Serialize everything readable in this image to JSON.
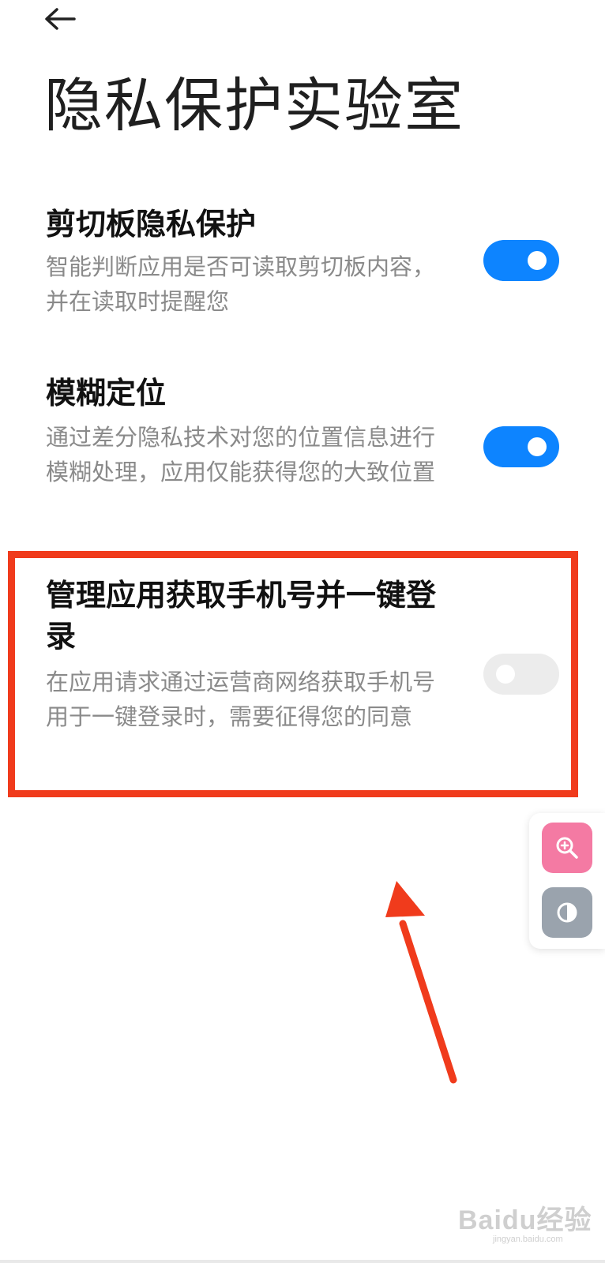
{
  "header": {
    "back_icon": "back-arrow-icon",
    "title": "隐私保护实验室"
  },
  "settings": [
    {
      "title": "剪切板隐私保护",
      "description": "智能判断应用是否可读取剪切板内容，并在读取时提醒您",
      "enabled": true
    },
    {
      "title": "模糊定位",
      "description": "通过差分隐私技术对您的位置信息进行模糊处理，应用仅能获得您的大致位置",
      "enabled": true
    },
    {
      "title": "管理应用获取手机号并一键登录",
      "description": "在应用请求通过运营商网络获取手机号用于一键登录时，需要征得您的同意",
      "enabled": false
    }
  ],
  "floating_tools": [
    {
      "icon": "zoom-in-icon",
      "color": "#f47aa3"
    },
    {
      "icon": "contrast-icon",
      "color": "#9aa3ad"
    }
  ],
  "colors": {
    "toggle_on": "#0d84ff",
    "toggle_off": "#ececec",
    "annotation": "#f03b1c"
  },
  "watermark": {
    "logo": "Baidu经验",
    "url": "jingyan.baidu.com"
  }
}
